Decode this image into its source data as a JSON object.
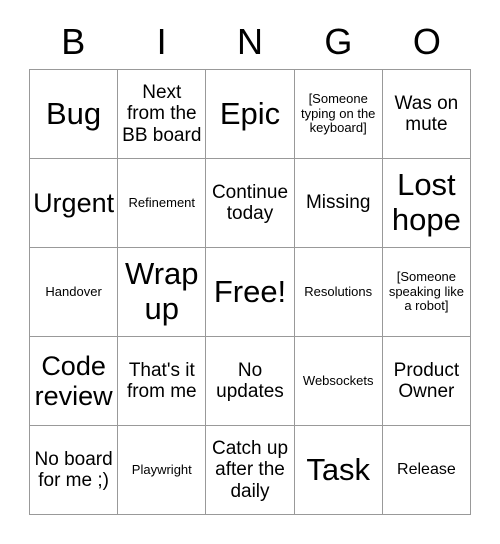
{
  "card": {
    "title": "BINGO",
    "headers": [
      "B",
      "I",
      "N",
      "G",
      "O"
    ],
    "colors": {
      "background": "#ffffff",
      "text": "#000000",
      "border": "#999999"
    },
    "cells": [
      {
        "text": "Bug",
        "size": "xl"
      },
      {
        "text": "Next from the BB board",
        "size": "md"
      },
      {
        "text": "Epic",
        "size": "xl"
      },
      {
        "text": "[Someone typing on the keyboard]",
        "size": "xs"
      },
      {
        "text": "Was on mute",
        "size": "md"
      },
      {
        "text": "Urgent",
        "size": "lg"
      },
      {
        "text": "Refinement",
        "size": "xs"
      },
      {
        "text": "Continue today",
        "size": "md"
      },
      {
        "text": "Missing",
        "size": "md"
      },
      {
        "text": "Lost hope",
        "size": "xl"
      },
      {
        "text": "Handover",
        "size": "xs"
      },
      {
        "text": "Wrap up",
        "size": "xl"
      },
      {
        "text": "Free!",
        "size": "xl"
      },
      {
        "text": "Resolutions",
        "size": "xs"
      },
      {
        "text": "[Someone speaking like a robot]",
        "size": "xs"
      },
      {
        "text": "Code review",
        "size": "lg"
      },
      {
        "text": "That's it from me",
        "size": "md"
      },
      {
        "text": "No updates",
        "size": "md"
      },
      {
        "text": "Websockets",
        "size": "xs"
      },
      {
        "text": "Product Owner",
        "size": "md"
      },
      {
        "text": "No board for me ;)",
        "size": "md"
      },
      {
        "text": "Playwright",
        "size": "xs"
      },
      {
        "text": "Catch up after the daily",
        "size": "md"
      },
      {
        "text": "Task",
        "size": "xl"
      },
      {
        "text": "Release",
        "size": "sm"
      }
    ]
  }
}
